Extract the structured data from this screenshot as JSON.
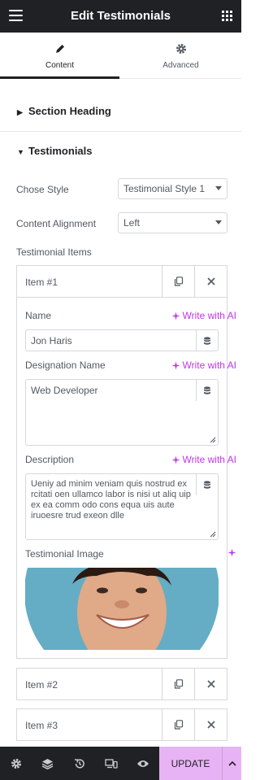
{
  "header": {
    "title": "Edit Testimonials"
  },
  "tabs": [
    {
      "label": "Content",
      "icon": "pencil-icon",
      "active": true
    },
    {
      "label": "Advanced",
      "icon": "gear-icon",
      "active": false
    }
  ],
  "sections": {
    "section_heading": "Section Heading",
    "testimonials": "Testimonials"
  },
  "controls": {
    "chose_style": {
      "label": "Chose Style",
      "value": "Testimonial Style 1"
    },
    "content_alignment": {
      "label": "Content Alignment",
      "value": "Left"
    },
    "items_label": "Testimonial Items"
  },
  "items": [
    {
      "title": "Item #1"
    },
    {
      "title": "Item #2"
    },
    {
      "title": "Item #3"
    }
  ],
  "fields": {
    "write_ai": "Write with AI",
    "name": {
      "label": "Name",
      "value": "Jon Haris"
    },
    "designation": {
      "label": "Designation Name",
      "value": "Web Developer"
    },
    "description": {
      "label": "Description",
      "value": "Ueniy ad minim veniam quis nostrud ex rcitati oen ullamco labor is nisi ut aliq uip ex ea comm odo cons equa uis aute iruoesre trud exeon dlle"
    },
    "image": {
      "label": "Testimonial Image"
    }
  },
  "footer": {
    "update_label": "UPDATE"
  },
  "colors": {
    "accent": "#c036e8",
    "update_bg": "#e8b3f5",
    "dark": "#1f2124"
  }
}
